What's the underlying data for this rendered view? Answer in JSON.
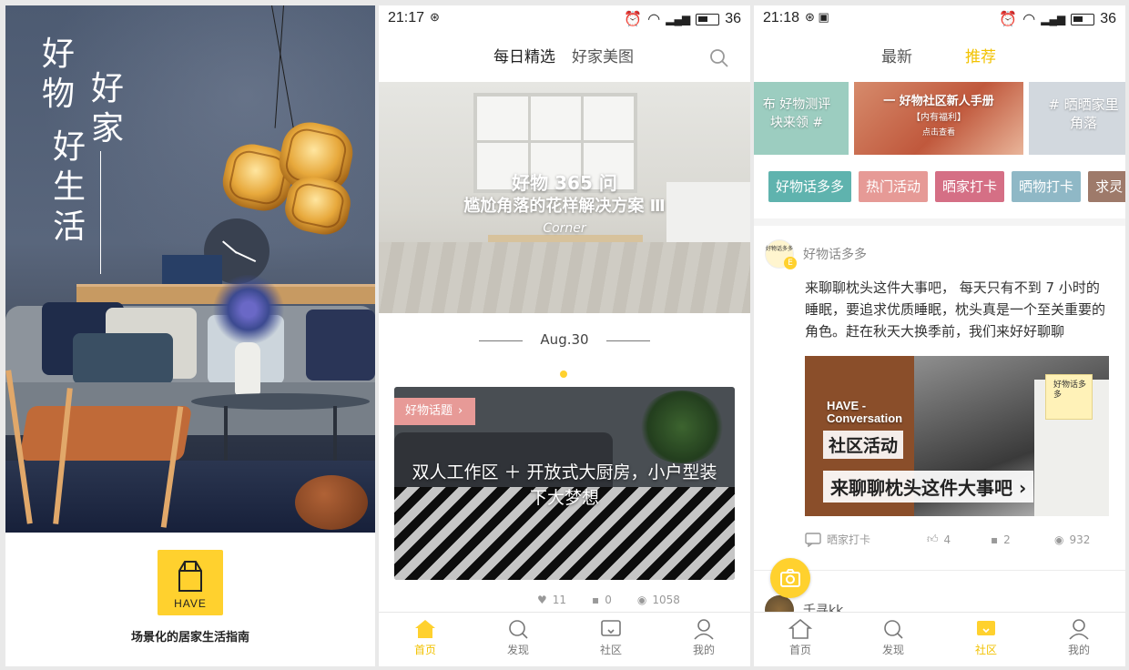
{
  "splash": {
    "title_col1": "好物",
    "title_col2": "好家",
    "title_col3": "好生活",
    "logo_text": "HAVE",
    "tagline": "场景化的居家生活指南"
  },
  "home": {
    "status": {
      "time": "21:17",
      "battery": "36"
    },
    "tabs": [
      "每日精选",
      "好家美图"
    ],
    "active_tab": 0,
    "banner": {
      "line1": "好物 365 问",
      "line2": "尴尬角落的花样解决方案 Ⅲ",
      "line3": "Corner"
    },
    "date": "Aug.30",
    "card": {
      "tag": "好物话题",
      "title": "双人工作区 ＋ 开放式大厨房，小户型装下大梦想"
    },
    "stats": {
      "likes": "11",
      "comments": "0",
      "views": "1058"
    },
    "nav": [
      "首页",
      "发现",
      "社区",
      "我的"
    ],
    "nav_active": 0
  },
  "community": {
    "status": {
      "time": "21:18",
      "battery": "36"
    },
    "tabs": [
      "最新",
      "推荐"
    ],
    "active_tab": 1,
    "topics": [
      {
        "line1": "布 好物测评",
        "line2": "块来领 #"
      },
      {
        "line1": "一 好物社区新人手册",
        "line2": "【内有福利】",
        "line3": "点击查看"
      },
      {
        "line1": "# 晒晒家里",
        "line2": "角落"
      }
    ],
    "categories": [
      {
        "label": "好物话多多",
        "color": "#5fb3ae"
      },
      {
        "label": "热门活动",
        "color": "#e69a96"
      },
      {
        "label": "晒家打卡",
        "color": "#d56f85"
      },
      {
        "label": "晒物打卡",
        "color": "#8fb8c6"
      },
      {
        "label": "求灵",
        "color": "#9e7a6a"
      }
    ],
    "post": {
      "author": "好物话多多",
      "avatar_text": "好物话多多",
      "badge": "E",
      "text": "来聊聊枕头这件大事吧，  每天只有不到 7 小时的睡眠，要追求优质睡眠，枕头真是一个至关重要的角色。赶在秋天大换季前，我们来好好聊聊",
      "img_have": "HAVE -",
      "img_conv": "Conversation",
      "img_h1": "社区活动",
      "img_h2": "来聊聊枕头这件大事吧 ›",
      "img_badge": "好物话多多",
      "category": "晒家打卡",
      "likes": "4",
      "comments": "2",
      "views": "932"
    },
    "next_author": "千寻kk",
    "nav": [
      "首页",
      "发现",
      "社区",
      "我的"
    ],
    "nav_active": 2
  },
  "colors": {
    "accent": "#ffd12e",
    "accent_text": "#f2c200"
  }
}
